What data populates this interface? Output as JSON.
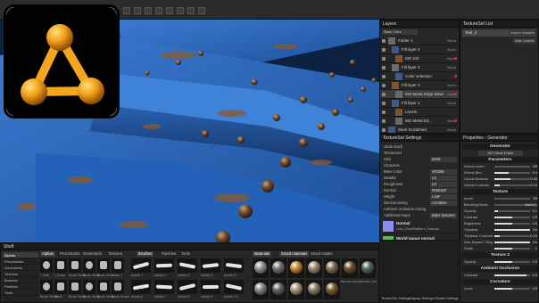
{
  "viewport": {
    "accent_blue": "#2a63b4",
    "rust": "#8a5a2e"
  },
  "layers": {
    "title": "Layers",
    "blend_label": "Base Color",
    "rows": [
      {
        "name": "Folder 1",
        "mode": "Norm"
      },
      {
        "name": "Fill layer 4",
        "mode": "Norm"
      },
      {
        "name": "MG Dirt",
        "mode": "Norm"
      },
      {
        "name": "Fill layer 3",
        "mode": "Norm"
      },
      {
        "name": "Color selection",
        "mode": ""
      },
      {
        "name": "Fill layer 2",
        "mode": "Norm"
      },
      {
        "name": "MG Metal Edge Wear",
        "mode": "Norm"
      },
      {
        "name": "Fill layer 1",
        "mode": "Norm"
      },
      {
        "name": "Levels",
        "mode": ""
      },
      {
        "name": "MG Metal Ed...",
        "mode": "Norm"
      },
      {
        "name": "Steel Scratched",
        "mode": "Norm"
      }
    ]
  },
  "textureset_list": {
    "title": "TextureSet List",
    "item": "Teel_2",
    "import_btn": "Import shaders",
    "main_btn": "Main shader"
  },
  "tss": {
    "title": "TextureSet Settings",
    "rows": [
      {
        "label": "Undo stack",
        "value": ""
      },
      {
        "label": "TextureSet",
        "value": ""
      },
      {
        "label": "Size",
        "value": "2048"
      },
      {
        "label": "Channels",
        "value": ""
      },
      {
        "label": "Base Color",
        "value": "sRGB8"
      },
      {
        "label": "Metallic",
        "value": "L8"
      },
      {
        "label": "Roughness",
        "value": "L8"
      },
      {
        "label": "Normal",
        "value": "RGB16F"
      },
      {
        "label": "Height",
        "value": "L16F"
      },
      {
        "label": "Normal mixing",
        "value": "Combine"
      },
      {
        "label": "Ambient occlusion mixing",
        "value": ""
      },
      {
        "label": "Additional maps",
        "value": "Bake textures"
      }
    ],
    "channels": [
      {
        "name": "Normal",
        "file": "Low_ClanPlatform_Normal",
        "color": "#8a8cf0"
      },
      {
        "name": "World space normal",
        "file": "World Space Normals Teel_1",
        "color": "#53c24a"
      },
      {
        "name": "ID",
        "file": "",
        "color": "#1ec23a"
      },
      {
        "name": "Ambient occlusion",
        "file": "Ambient Occlusion ... from Mesh Teel_1",
        "color": "#f0f0f0"
      },
      {
        "name": "Curvature",
        "file": "Curvature Teel_1",
        "color": "#9a9a9a"
      }
    ]
  },
  "props": {
    "title": "Properties - Generator",
    "sections": [
      "Generator",
      "Parameters",
      "Texture",
      "Texture 2",
      "Ambient Occlusion",
      "Curvature"
    ],
    "generator_name": "MG Mask Editor",
    "sliders": [
      {
        "label": "Global Invert",
        "value": "Off",
        "fill": 0
      },
      {
        "label": "Global Blur",
        "value": "0.4",
        "fill": 0.4
      },
      {
        "label": "Global Balance",
        "value": "0.46",
        "fill": 0.46
      },
      {
        "label": "Global Contrast",
        "value": "0.14",
        "fill": 0.14
      },
      {
        "label": "Invert",
        "value": "Off",
        "fill": 0
      },
      {
        "label": "Blending Mode",
        "value": "Multiply",
        "fill": 0
      },
      {
        "label": "Opacity",
        "value": "0.1",
        "fill": 0.1
      },
      {
        "label": "Contrast",
        "value": "0.5",
        "fill": 0.5
      },
      {
        "label": "Brightness",
        "value": "0.5",
        "fill": 0.5
      },
      {
        "label": "Triplanar",
        "value": "On",
        "fill": 1
      },
      {
        "label": "Triplanar Contrast",
        "value": "0.15",
        "fill": 0.15
      },
      {
        "label": "Non-Square Tiling",
        "value": "On",
        "fill": 1
      },
      {
        "label": "Scale",
        "value": "1",
        "fill": 0.5
      },
      {
        "label": "Opacity",
        "value": "0.5",
        "fill": 0.5
      },
      {
        "label": "Contrast",
        "value": "0.9",
        "fill": 0.9
      },
      {
        "label": "Level",
        "value": "0.5",
        "fill": 0.5
      }
    ]
  },
  "shelf": {
    "title": "Shelf",
    "categories": [
      "Alphas",
      "Procedurals",
      "Generators",
      "Textures",
      "Brushes",
      "Particles",
      "Tools",
      "Materials",
      "Smart materials",
      "Smart masks",
      "Filters",
      "Environments"
    ],
    "tabs": [
      "Alphas",
      "Procedurals",
      "Generators",
      "Textures",
      "Brushes",
      "Particles",
      "Tools",
      "Materials",
      "Smart materials",
      "Smart masks"
    ],
    "alpha_labels": [
      "1 Dots",
      "1 Cross",
      "Brush Stroke",
      "Brush Stroke",
      "Brush Stroke",
      "Cross 1",
      "Brush Stroke",
      "Circle",
      "Brush Stroke",
      "Brush Stroke",
      "Brush Stroke",
      "Brush Stroke"
    ],
    "brush_labels": [
      "Artistic 1",
      "Artistic 2",
      "Artistic 3",
      "Artistic 4",
      "Artistic 5",
      "Artistic 6",
      "Artistic 7",
      "Artistic 8",
      "Artistic 9",
      "Artistic 10"
    ],
    "material_labels": [
      "Aluminium...",
      "Aluminium...",
      "Beeswax",
      "Bone",
      "Bone Stylized",
      "Bronze Armor",
      "Bronze Corr...",
      "Aluminium",
      "Aluminium",
      "Bone",
      "Bone",
      "Bronze"
    ],
    "material_colors": [
      "#8f9397",
      "#6f7478",
      "#c48c2a",
      "#9b8a6c",
      "#7f6f55",
      "#6b4e2a",
      "#4f6d57",
      "#80868a",
      "#5c6165",
      "#a59677",
      "#8c7b5f",
      "#7a5b2f"
    ]
  },
  "bottom_tabs": [
    "TextureSet Settings",
    "Display Settings",
    "Shader Settings"
  ]
}
